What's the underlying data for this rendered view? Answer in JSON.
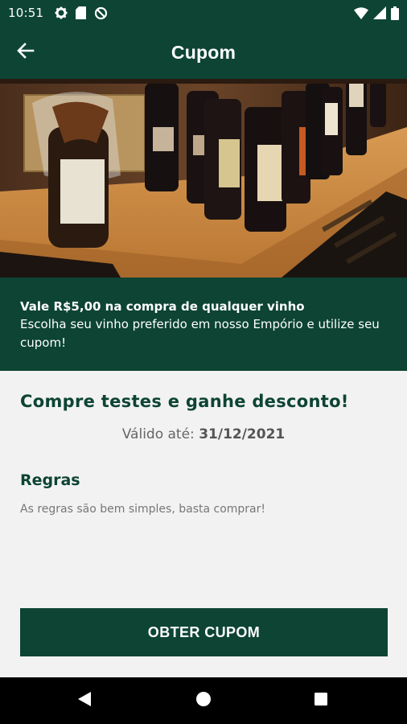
{
  "status_bar": {
    "time": "10:51",
    "icons_left": [
      "gear-icon",
      "sd-card-icon",
      "data-saver-icon"
    ],
    "icons_right": [
      "wifi-icon",
      "signal-icon",
      "battery-icon"
    ]
  },
  "app_bar": {
    "title": "Cupom",
    "back_icon": "arrow-left-icon"
  },
  "hero": {
    "alt": "wine-bottles-on-shelf-photo"
  },
  "coupon": {
    "headline": "Vale R$5,00 na compra de qualquer vinho",
    "description": "Escolha seu vinho preferido em nosso Empório e utilize seu cupom!"
  },
  "content": {
    "title": "Compre testes e ganhe desconto!",
    "validity_label": "Válido até:",
    "validity_date": "31/12/2021",
    "rules_heading": "Regras",
    "rules_text": "As regras são bem simples, basta comprar!",
    "cta_label": "OBTER CUPOM"
  },
  "nav_bar": {
    "buttons": [
      "back-triangle-icon",
      "home-circle-icon",
      "recents-square-icon"
    ]
  },
  "colors": {
    "primary": "#0d4434",
    "background": "#f2f2f2",
    "text_muted": "#777777"
  }
}
